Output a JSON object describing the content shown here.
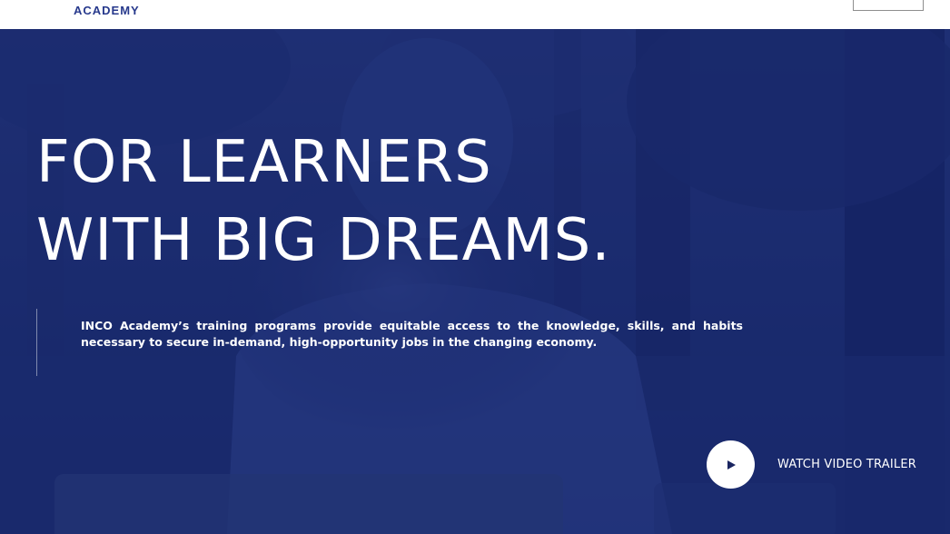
{
  "header": {
    "logo_text": "ACADEMY",
    "menu_button_label": ""
  },
  "hero": {
    "headline_line1": "FOR LEARNERS",
    "headline_line2": "WITH BIG DREAMS.",
    "description": "INCO Academy’s training programs provide equitable access to the knowledge, skills, and habits necessary to secure in-demand, high-opportunity jobs in the changing economy.",
    "trailer_label": "WATCH VIDEO TRAILER",
    "play_icon": "play-icon"
  },
  "colors": {
    "brand": "#27398c",
    "overlay": "#14246c",
    "text_light": "#ffffff"
  }
}
